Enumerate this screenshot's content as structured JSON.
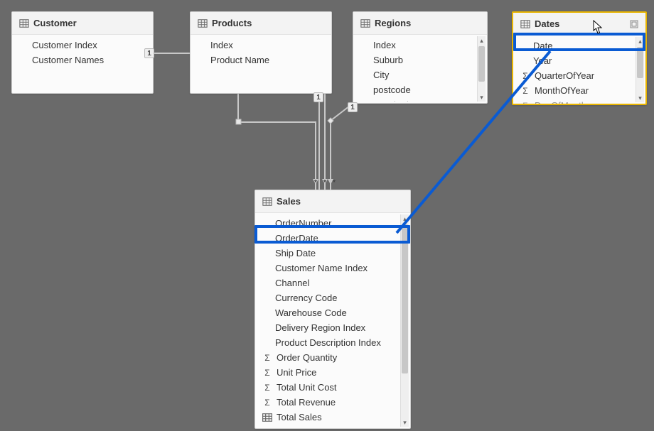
{
  "colors": {
    "highlight": "#0a5bd3",
    "selected_border": "#e8b400",
    "background": "#6a6a6a",
    "card_bg": "#fbfbfb"
  },
  "tables": {
    "customer": {
      "title": "Customer",
      "fields": [
        {
          "label": "Customer Index",
          "type": "field"
        },
        {
          "label": "Customer Names",
          "type": "field"
        }
      ]
    },
    "products": {
      "title": "Products",
      "fields": [
        {
          "label": "Index",
          "type": "field"
        },
        {
          "label": "Product Name",
          "type": "field"
        }
      ]
    },
    "regions": {
      "title": "Regions",
      "fields": [
        {
          "label": "Index",
          "type": "field"
        },
        {
          "label": "Suburb",
          "type": "field"
        },
        {
          "label": "City",
          "type": "field"
        },
        {
          "label": "postcode",
          "type": "field"
        },
        {
          "label": "Longitude",
          "type": "field"
        }
      ]
    },
    "dates": {
      "title": "Dates",
      "fields": [
        {
          "label": "Date",
          "type": "field"
        },
        {
          "label": "Year",
          "type": "field"
        },
        {
          "label": "QuarterOfYear",
          "type": "measure"
        },
        {
          "label": "MonthOfYear",
          "type": "measure"
        },
        {
          "label": "DayOfMonth",
          "type": "measure"
        }
      ]
    },
    "sales": {
      "title": "Sales",
      "fields": [
        {
          "label": "OrderNumber",
          "type": "field"
        },
        {
          "label": "OrderDate",
          "type": "field"
        },
        {
          "label": "Ship Date",
          "type": "field"
        },
        {
          "label": "Customer Name Index",
          "type": "field"
        },
        {
          "label": "Channel",
          "type": "field"
        },
        {
          "label": "Currency Code",
          "type": "field"
        },
        {
          "label": "Warehouse Code",
          "type": "field"
        },
        {
          "label": "Delivery Region Index",
          "type": "field"
        },
        {
          "label": "Product Description Index",
          "type": "field"
        },
        {
          "label": "Order Quantity",
          "type": "measure"
        },
        {
          "label": "Unit Price",
          "type": "measure"
        },
        {
          "label": "Total Unit Cost",
          "type": "measure"
        },
        {
          "label": "Total Revenue",
          "type": "measure"
        },
        {
          "label": "Total Sales",
          "type": "table"
        }
      ]
    }
  },
  "relationships": {
    "one_label": "1",
    "many_label": "*"
  },
  "highlighted_fields": [
    "Date",
    "OrderDate"
  ]
}
